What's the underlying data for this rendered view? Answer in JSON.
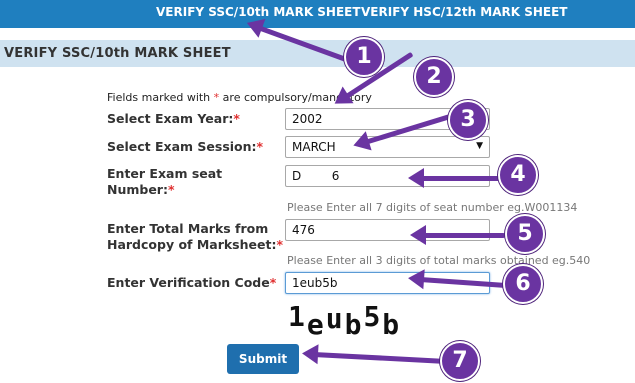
{
  "tabs": [
    {
      "label": "VERIFY SSC/10th MARK SHEET"
    },
    {
      "label": "VERIFY HSC/12th MARK SHEET"
    }
  ],
  "section_title": "VERIFY SSC/10th MARK SHEET",
  "form": {
    "note_prefix": "Fields marked with",
    "note_star": "*",
    "note_suffix": "are compulsory/mandatory",
    "exam_year": {
      "label": "Select Exam Year:",
      "value": "2002"
    },
    "exam_session": {
      "label": "Select Exam Session:",
      "value": "MARCH"
    },
    "seat_number": {
      "label_line1": "Enter Exam seat",
      "label_line2": "Number:",
      "value": "D        6",
      "hint": "Please Enter all 7 digits of seat number eg.W001134"
    },
    "total_marks": {
      "label_line1": "Enter Total Marks from",
      "label_line2": "Hardcopy of Marksheet:",
      "value": "476",
      "hint": "Please Enter all 3 digits of total marks obtained eg.540"
    },
    "verification_code": {
      "label": "Enter Verification Code",
      "value": "1eub5b"
    },
    "required_mark": "*",
    "captcha_chars": [
      "1",
      "e",
      "u",
      "b",
      "5",
      "b"
    ],
    "submit_label": "Submit"
  },
  "annotations": [
    {
      "number": "1"
    },
    {
      "number": "2"
    },
    {
      "number": "3"
    },
    {
      "number": "4"
    },
    {
      "number": "5"
    },
    {
      "number": "6"
    },
    {
      "number": "7"
    }
  ],
  "colors": {
    "accent": "#1f7fbf",
    "annotation": "#6a34a1",
    "required": "#e03030"
  }
}
